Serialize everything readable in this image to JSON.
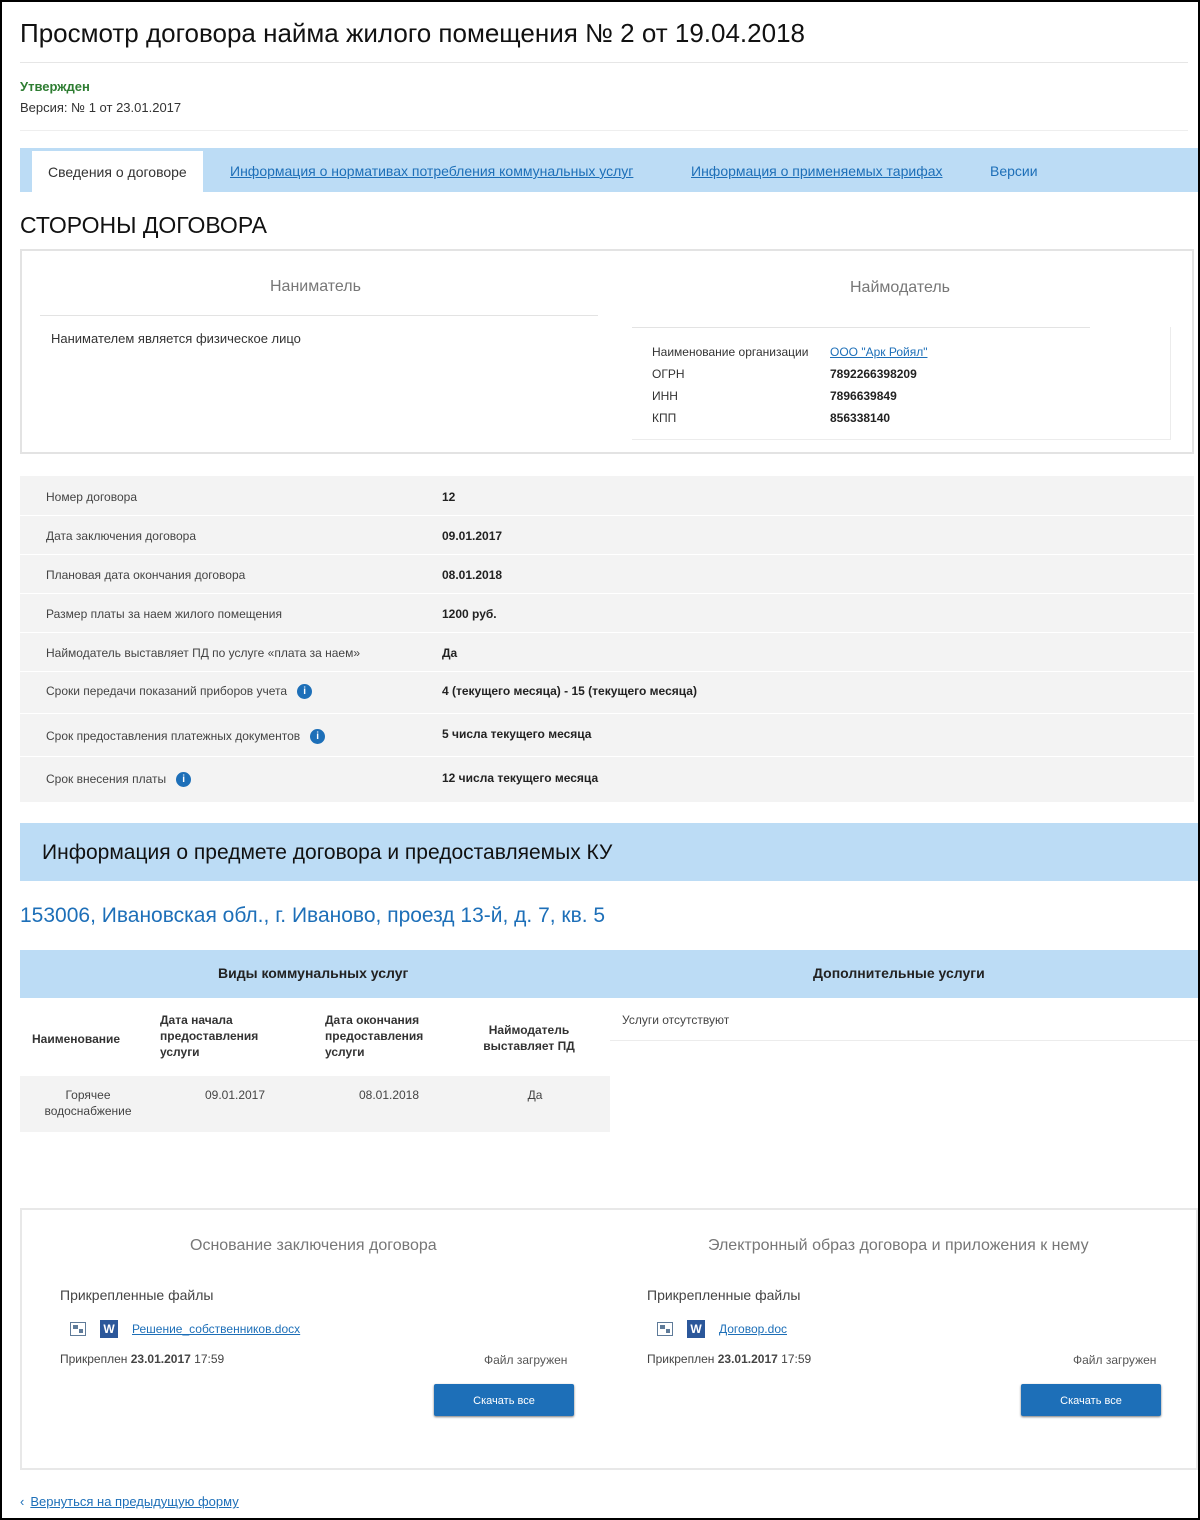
{
  "page": {
    "title": "Просмотр договора найма жилого помещения № 2 от 19.04.2018",
    "status": "Утвержден",
    "version": "Версия: № 1 от 23.01.2017"
  },
  "tabs": [
    {
      "label": "Сведения о договоре",
      "active": true
    },
    {
      "label": "Информация о нормативах потребления коммунальных услуг",
      "active": false
    },
    {
      "label": "Информация о применяемых тарифах",
      "active": false
    },
    {
      "label": "Версии",
      "active": false
    }
  ],
  "parties": {
    "heading": "СТОРОНЫ ДОГОВОРА",
    "tenant": {
      "title": "Наниматель",
      "text": "Нанимателем является физическое лицо"
    },
    "landlord": {
      "title": "Наймодатель",
      "org_name_label": "Наименование организации",
      "org_name": "ООО \"Арк Ройял\"",
      "ogrn_label": "ОГРН",
      "ogrn": "7892266398209",
      "inn_label": "ИНН",
      "inn": "7896639849",
      "kpp_label": "КПП",
      "kpp": "856338140"
    }
  },
  "details": [
    {
      "label": "Номер договора",
      "value": "12"
    },
    {
      "label": "Дата заключения договора",
      "value": "09.01.2017"
    },
    {
      "label": "Плановая дата окончания договора",
      "value": "08.01.2018"
    },
    {
      "label": "Размер платы за наем жилого помещения",
      "value": "1200 руб."
    },
    {
      "label": "Наймодатель выставляет ПД по услуге «плата за наем»",
      "value": "Да"
    },
    {
      "label": "Сроки передачи показаний приборов учета",
      "value": "4 (текущего месяца) - 15 (текущего месяца)"
    },
    {
      "label": "Срок предоставления платежных документов",
      "value": "5 числа текущего месяца"
    },
    {
      "label": "Срок внесения платы",
      "value": "12 числа текущего месяца"
    }
  ],
  "info_icon": "i",
  "subject": {
    "heading": "Информация о предмете договора и предоставляемых КУ",
    "address": "153006, Ивановская обл., г. Иваново, проезд 13-й, д. 7, кв. 5",
    "ku_title": "Виды коммунальных услуг",
    "extra_title": "Дополнительные услуги",
    "columns": [
      "Наименование",
      "Дата начала предоставления услуги",
      "Дата окончания предоставления услуги",
      "Наймодатель выставляет ПД"
    ],
    "rows": [
      {
        "name": "Горячее водоснабжение",
        "start": "09.01.2017",
        "end": "08.01.2018",
        "pd": "Да"
      }
    ],
    "extra_none": "Услуги отсутствуют"
  },
  "documents": {
    "left": {
      "title": "Основание заключения договора",
      "attached": "Прикрепленные файлы",
      "file_icon": "W",
      "file": "Решение_собственников.docx",
      "attached_prefix": "Прикреплен",
      "attached_date": "23.01.2017",
      "attached_time": "17:59",
      "loaded": "Файл загружен",
      "button": "Скачать все"
    },
    "right": {
      "title": "Электронный образ договора и приложения к нему",
      "attached": "Прикрепленные файлы",
      "file_icon": "W",
      "file": "Договор.doc",
      "attached_prefix": "Прикреплен",
      "attached_date": "23.01.2017",
      "attached_time": "17:59",
      "loaded": "Файл загружен",
      "button": "Скачать все"
    }
  },
  "footer": {
    "back_arrow": "‹",
    "back_link": "Вернуться на предыдущую форму"
  }
}
